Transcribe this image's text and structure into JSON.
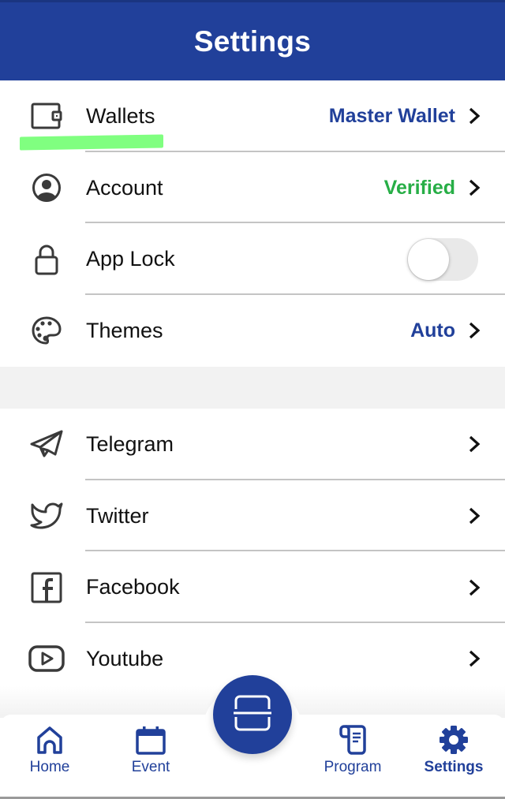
{
  "header": {
    "title": "Settings"
  },
  "colors": {
    "brand": "#21409a",
    "verified": "#27ae46",
    "highlight": "#80ff80",
    "section_gap": "#f2f2f2"
  },
  "settings_group": [
    {
      "icon": "wallet-icon",
      "label": "Wallets",
      "value": "Master Wallet",
      "value_color": "blue",
      "chevron": true
    },
    {
      "icon": "account-circle-icon",
      "label": "Account",
      "value": "Verified",
      "value_color": "green",
      "chevron": true
    },
    {
      "icon": "lock-icon",
      "label": "App Lock",
      "toggle": {
        "on": false
      }
    },
    {
      "icon": "palette-icon",
      "label": "Themes",
      "value": "Auto",
      "value_color": "blue",
      "chevron": true
    }
  ],
  "social_group": [
    {
      "icon": "telegram-icon",
      "label": "Telegram",
      "chevron": true
    },
    {
      "icon": "twitter-icon",
      "label": "Twitter",
      "chevron": true
    },
    {
      "icon": "facebook-icon",
      "label": "Facebook",
      "chevron": true
    },
    {
      "icon": "youtube-icon",
      "label": "Youtube",
      "chevron": true
    }
  ],
  "tabbar": {
    "tabs": [
      {
        "icon": "home-icon",
        "label": "Home",
        "active": false
      },
      {
        "icon": "calendar-icon",
        "label": "Event",
        "active": false
      },
      {
        "icon": "scroll-icon",
        "label": "Program",
        "active": false
      },
      {
        "icon": "gear-icon",
        "label": "Settings",
        "active": true
      }
    ],
    "center_button": {
      "icon": "scan-icon"
    }
  }
}
